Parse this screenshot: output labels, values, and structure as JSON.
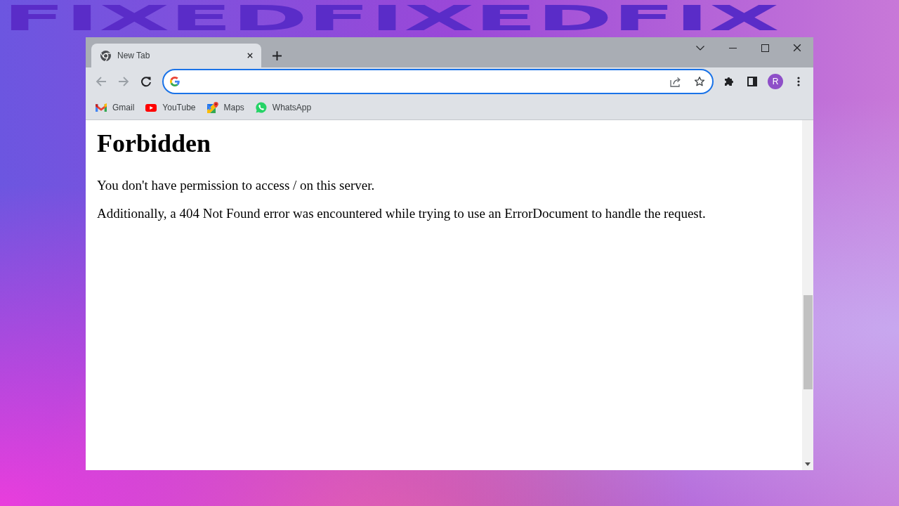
{
  "banner": {
    "text": "FIXEDFIXEDFIX"
  },
  "browser": {
    "tabs": [
      {
        "title": "New Tab",
        "selected": true
      }
    ],
    "nav_buttons": [
      {
        "kind": "back",
        "disabled": true
      },
      {
        "kind": "forward",
        "disabled": true
      },
      {
        "kind": "reload",
        "disabled": false
      }
    ],
    "profile": {
      "initial": "R"
    },
    "bookmarks": [
      {
        "kind": "gmail",
        "label": "Gmail"
      },
      {
        "kind": "youtube",
        "label": "YouTube"
      },
      {
        "kind": "maps",
        "label": "Maps"
      },
      {
        "kind": "whatsapp",
        "label": "WhatsApp"
      }
    ]
  },
  "page": {
    "heading": "Forbidden",
    "paragraphs": [
      "You don't have permission to access / on this server.",
      "Additionally, a 404 Not Found error was encountered while trying to use an ErrorDocument to handle the request."
    ]
  }
}
